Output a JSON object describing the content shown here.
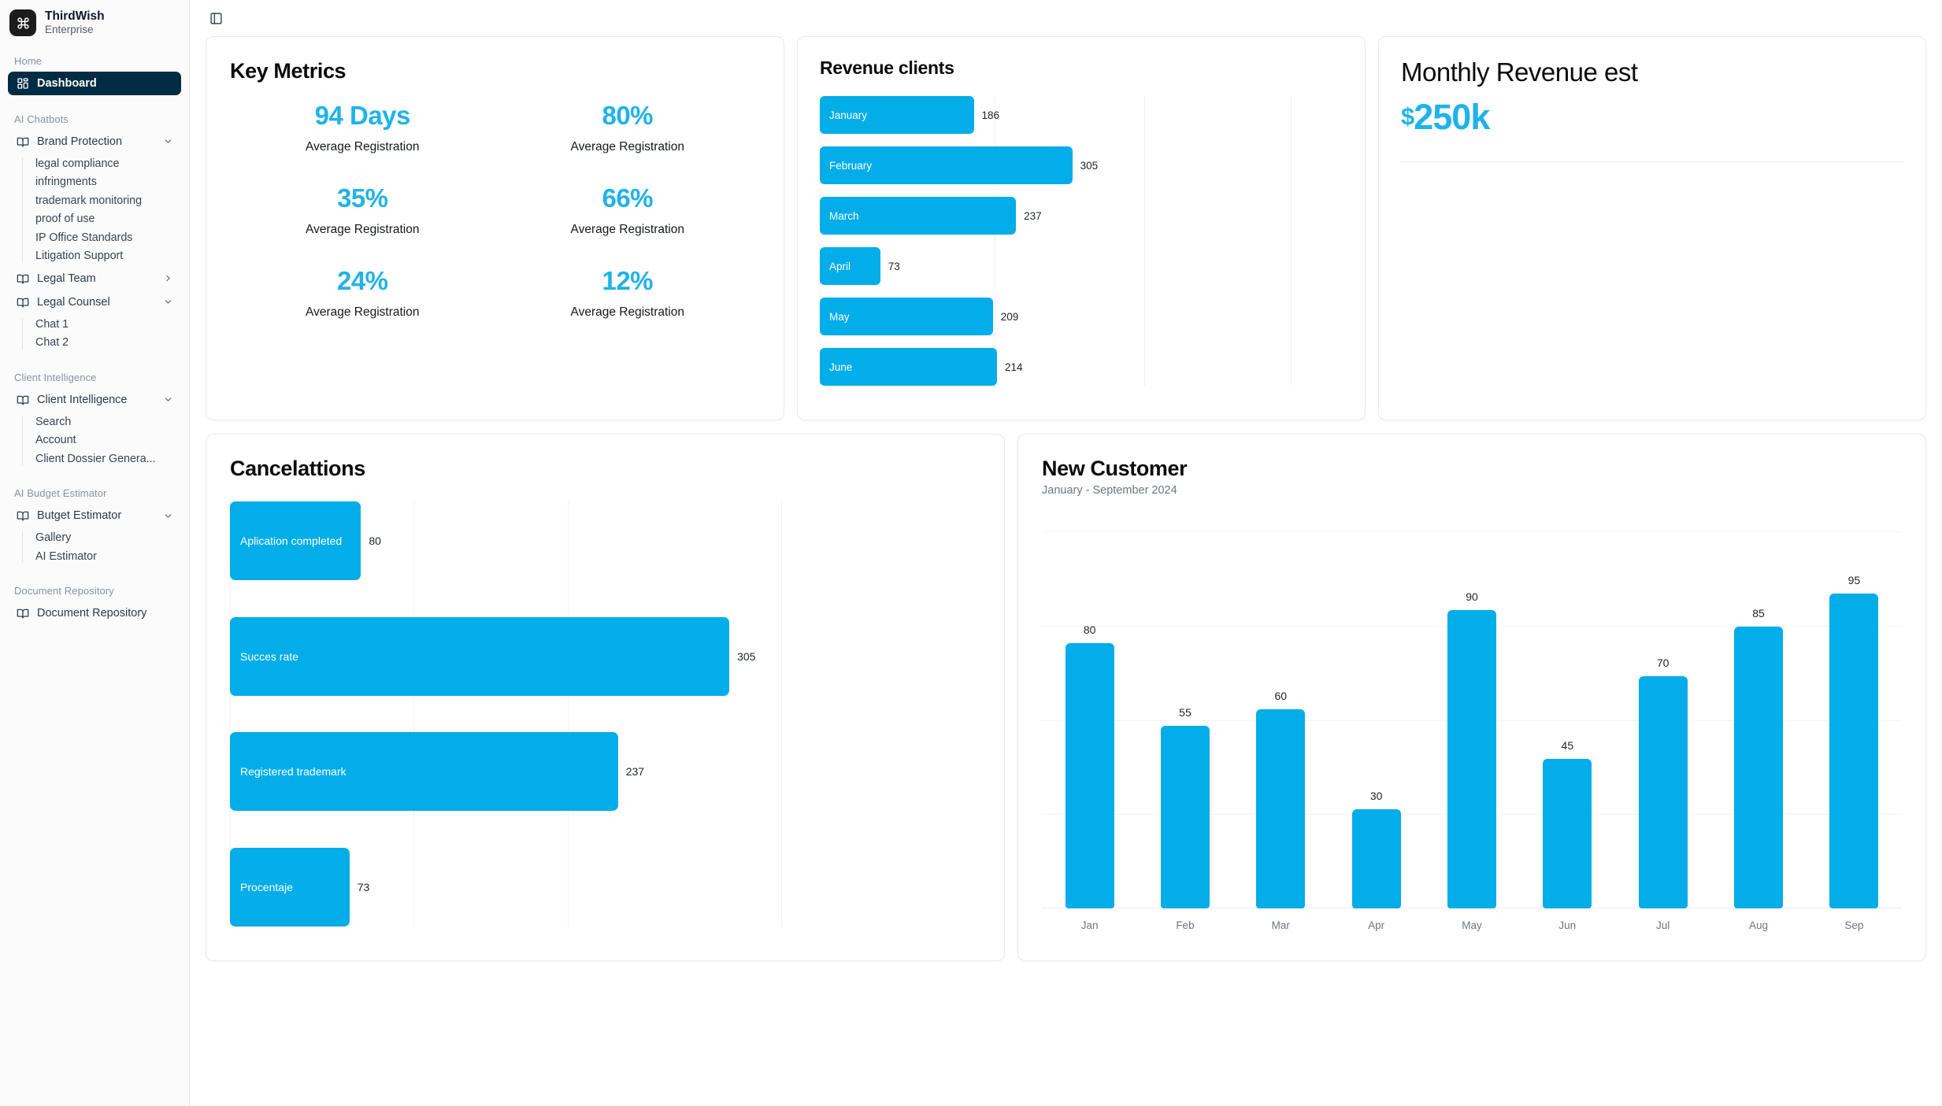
{
  "brand": {
    "name": "ThirdWish",
    "plan": "Enterprise",
    "logo_icon": "command-icon",
    "logo_bg": "#1c1c1c"
  },
  "accent": "#03ade8",
  "accent_text": "#1fb3ea",
  "active_bg": "#022c43",
  "topbar": {
    "toggle_icon": "panel-left-icon"
  },
  "sidebar": {
    "groups": [
      {
        "label": "Home",
        "items": [
          {
            "label": "Dashboard",
            "icon": "layout-grid-icon",
            "active": true,
            "chevron": "none",
            "children": []
          }
        ]
      },
      {
        "label": "AI Chatbots",
        "items": [
          {
            "label": "Brand Protection",
            "icon": "book-open-icon",
            "active": false,
            "chevron": "down",
            "children": [
              "legal compliance",
              "infringments",
              "trademark monitoring",
              "proof of use",
              "IP Office Standards",
              "Litigation Support"
            ]
          },
          {
            "label": "Legal Team",
            "icon": "book-open-icon",
            "active": false,
            "chevron": "right",
            "children": []
          },
          {
            "label": "Legal Counsel",
            "icon": "book-open-icon",
            "active": false,
            "chevron": "down",
            "children": [
              "Chat 1",
              "Chat 2"
            ]
          }
        ]
      },
      {
        "label": "Client Intelligence",
        "items": [
          {
            "label": "Client Intelligence",
            "icon": "book-open-icon",
            "active": false,
            "chevron": "down",
            "children": [
              "Search",
              "Account",
              "Client Dossier Genera..."
            ]
          }
        ]
      },
      {
        "label": "AI Budget Estimator",
        "items": [
          {
            "label": "Butget Estimator",
            "icon": "book-open-icon",
            "active": false,
            "chevron": "down",
            "children": [
              "Gallery",
              "AI Estimator"
            ]
          }
        ]
      },
      {
        "label": "Document Repository",
        "items": [
          {
            "label": "Document Repository",
            "icon": "book-open-icon",
            "active": false,
            "chevron": "none",
            "children": []
          }
        ]
      }
    ]
  },
  "key_metrics": {
    "title": "Key Metrics",
    "items": [
      {
        "value": "94 Days",
        "label": "Average Registration"
      },
      {
        "value": "80%",
        "label": "Average Registration"
      },
      {
        "value": "35%",
        "label": "Average Registration"
      },
      {
        "value": "66%",
        "label": "Average Registration"
      },
      {
        "value": "24%",
        "label": "Average Registration"
      },
      {
        "value": "12%",
        "label": "Average Registration"
      }
    ]
  },
  "monthly_revenue": {
    "title": "Monthly Revenue est",
    "currency": "$",
    "amount": "250k"
  },
  "chart_data": [
    {
      "type": "bar",
      "orientation": "horizontal",
      "title": "Revenue clients",
      "categories": [
        "January",
        "February",
        "March",
        "April",
        "May",
        "June"
      ],
      "values": [
        186,
        305,
        237,
        73,
        209,
        214
      ],
      "xlabel": "",
      "ylabel": "",
      "xlim": [
        0,
        390
      ],
      "grid": true,
      "legend": "none"
    },
    {
      "type": "bar",
      "orientation": "horizontal",
      "title": "Cancelattions",
      "categories": [
        "Aplication completed",
        "Succes rate",
        "Registered trademark",
        "Procentaje"
      ],
      "values": [
        80,
        305,
        237,
        73
      ],
      "xlabel": "",
      "ylabel": "",
      "xlim": [
        0,
        380
      ],
      "grid": true,
      "legend": "none"
    },
    {
      "type": "bar",
      "orientation": "vertical",
      "title": "New Customer",
      "subtitle": "January - September 2024",
      "categories": [
        "Jan",
        "Feb",
        "Mar",
        "Apr",
        "May",
        "Jun",
        "Jul",
        "Aug",
        "Sep"
      ],
      "values": [
        80,
        55,
        60,
        30,
        90,
        45,
        70,
        85,
        95
      ],
      "xlabel": "",
      "ylabel": "",
      "ylim": [
        0,
        100
      ],
      "grid": true,
      "legend": "none"
    }
  ]
}
